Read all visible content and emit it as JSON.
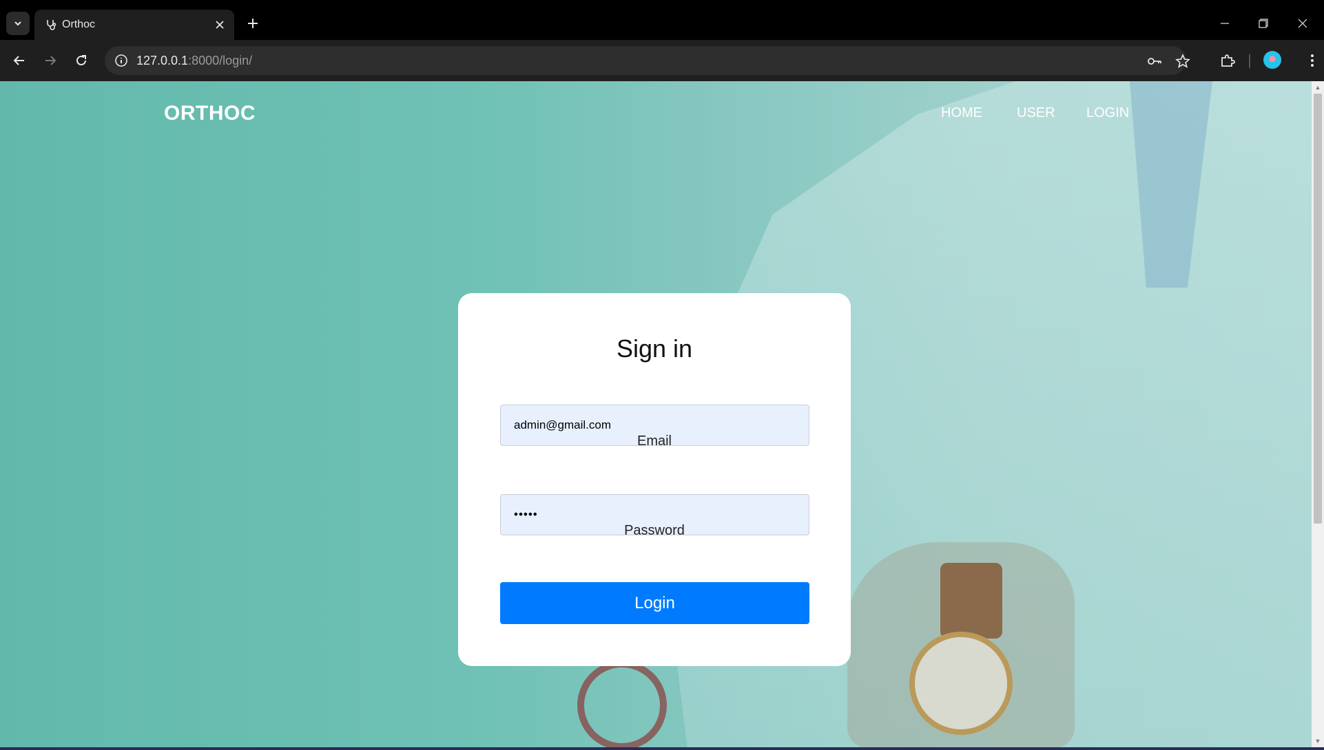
{
  "browser": {
    "tab_title": "Orthoc",
    "url_host": "127.0.0.1",
    "url_path": ":8000/login/"
  },
  "site": {
    "brand": "ORTHOC",
    "nav": [
      "HOME",
      "USER",
      "LOGIN"
    ]
  },
  "login_form": {
    "title": "Sign in",
    "email_value": "admin@gmail.com",
    "email_label": "Email",
    "password_value": "•••••",
    "password_label": "Password",
    "submit_label": "Login"
  },
  "colors": {
    "accent": "#007bff",
    "input_bg": "#e8f0fe",
    "bg_teal": "#6ec1b4"
  }
}
